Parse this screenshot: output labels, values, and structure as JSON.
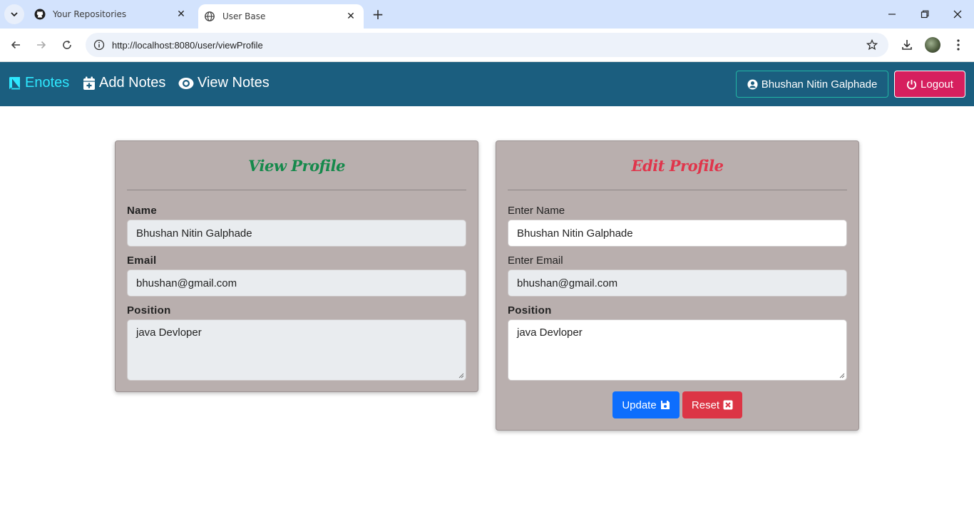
{
  "browser": {
    "tabs": [
      {
        "title": "Your Repositories",
        "icon": "github-icon",
        "active": false
      },
      {
        "title": "User Base",
        "icon": "globe-icon",
        "active": true
      }
    ],
    "url": "http://localhost:8080/user/viewProfile"
  },
  "navbar": {
    "brand": "Enotes",
    "links": [
      "Add Notes",
      "View Notes"
    ],
    "user_button": "Bhushan Nitin Galphade",
    "logout_button": "Logout",
    "colors": {
      "bar": "#1b5e7f",
      "brand": "#2ee8ff",
      "logout": "#d61f5e"
    }
  },
  "view_profile": {
    "title": "View Profile",
    "name_label": "Name",
    "name_value": "Bhushan Nitin Galphade",
    "email_label": "Email",
    "email_value": "bhushan@gmail.com",
    "position_label": "Position",
    "position_value": "java Devloper"
  },
  "edit_profile": {
    "title": "Edit Profile",
    "name_label": "Enter Name",
    "name_value": "Bhushan Nitin Galphade",
    "email_label": "Enter Email",
    "email_value": "bhushan@gmail.com",
    "position_label": "Position",
    "position_value": "java Devloper",
    "update_button": "Update",
    "reset_button": "Reset"
  }
}
